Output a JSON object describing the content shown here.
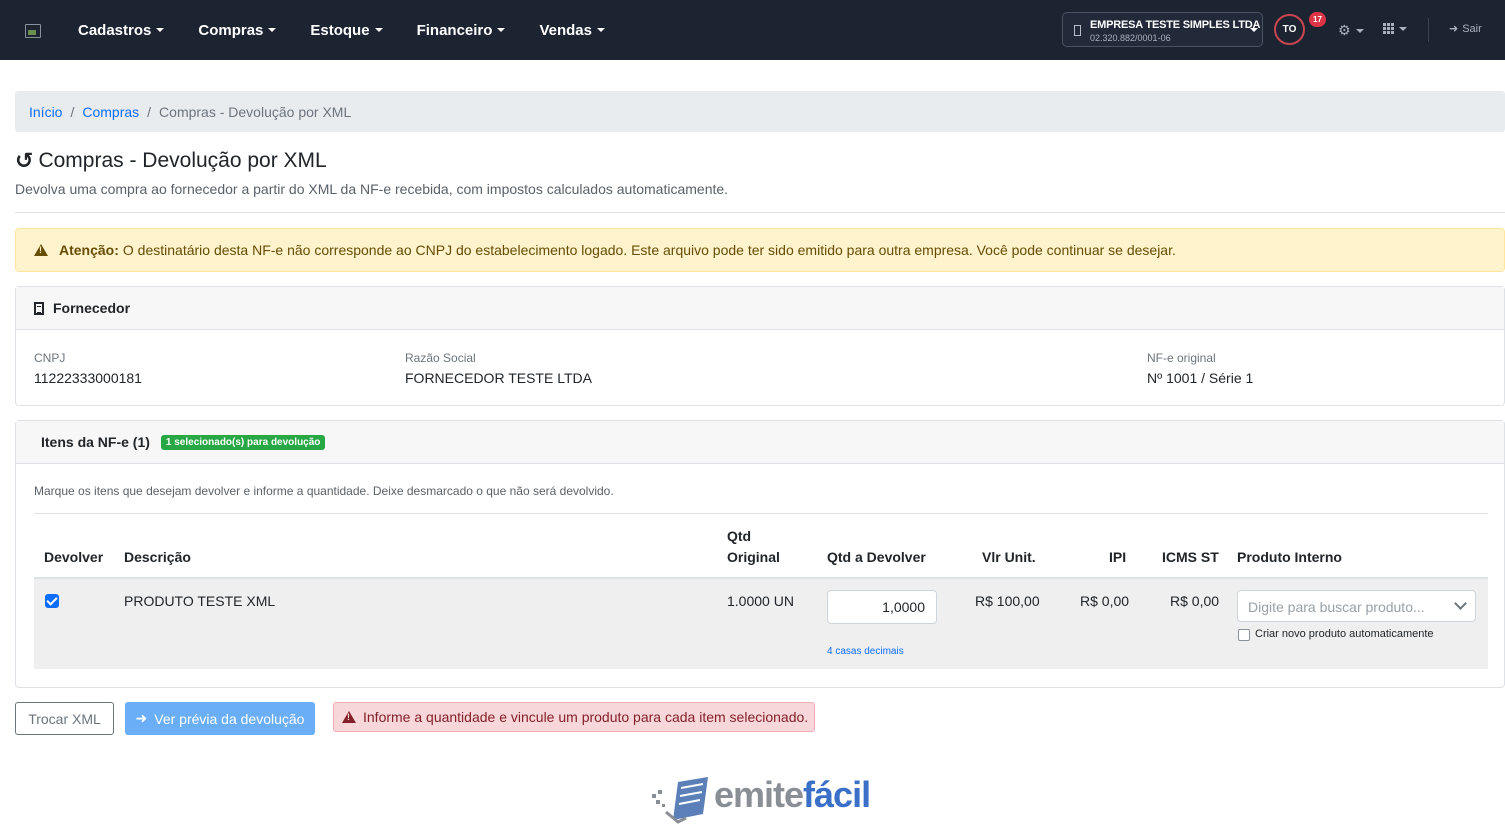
{
  "nav": {
    "menu": [
      {
        "label": "Cadastros"
      },
      {
        "label": "Compras"
      },
      {
        "label": "Estoque"
      },
      {
        "label": "Financeiro"
      },
      {
        "label": "Vendas"
      }
    ],
    "company": {
      "name": "EMPRESA TESTE SIMPLES LTDA",
      "cnpj": "02.320.882/0001-06"
    },
    "avatar_initials": "TO",
    "notification_count": "17",
    "logout_label": "Sair",
    "background_color": "#1c2331"
  },
  "breadcrumb": {
    "home": "Início",
    "section": "Compras",
    "current": "Compras - Devolução por XML"
  },
  "page": {
    "title": "Compras - Devolução por XML",
    "subtitle": "Devolva uma compra ao fornecedor a partir do XML da NF-e recebida, com impostos calculados automaticamente.",
    "title_icon": "undo-icon"
  },
  "warning": {
    "strong": "Atenção:",
    "text": "O destinatário desta NF-e não corresponde ao CNPJ do estabelecimento logado. Este arquivo pode ter sido emitido para outra empresa. Você pode continuar se desejar."
  },
  "fornecedor": {
    "header": "Fornecedor",
    "cnpj_label": "CNPJ",
    "cnpj_value": "11222333000181",
    "razao_label": "Razão Social",
    "razao_value": "FORNECEDOR TESTE LTDA",
    "nfe_label": "NF-e original",
    "nfe_value": "Nº 1001 / Série 1"
  },
  "itens": {
    "header": "Itens da NF-e (1)",
    "badge": "1 selecionado(s) para devolução",
    "badge_color": "#28a745",
    "instructions": "Marque os itens que desejam devolver e informe a quantidade. Deixe desmarcado o que não será devolvido.",
    "columns": {
      "devolver": "Devolver",
      "descricao": "Descrição",
      "qtd_original_1": "Qtd",
      "qtd_original_2": "Original",
      "qtd_devolver": "Qtd a Devolver",
      "vlr_unit": "Vlr Unit.",
      "ipi": "IPI",
      "icms_st": "ICMS ST",
      "produto_interno": "Produto Interno"
    },
    "rows": [
      {
        "checked": true,
        "descricao": "PRODUTO TESTE XML",
        "qtd_original": "1.0000 UN",
        "qtd_devolver": "1,0000",
        "decimals_hint": "4 casas decimais",
        "vlr_unit": "R$ 100,00",
        "ipi": "R$ 0,00",
        "icms_st": "R$ 0,00",
        "produto_placeholder": "Digite para buscar produto...",
        "novo_produto_label": "Criar novo produto automaticamente",
        "novo_produto_checked": false
      }
    ]
  },
  "actions": {
    "trocar_xml": "Trocar XML",
    "ver_previa": "Ver prévia da devolução",
    "error": "Informe a quantidade e vincule um produto para cada item selecionado.",
    "primary_color": "#6aaef7"
  },
  "footer": {
    "logo_part1": "emite",
    "logo_part2": "fácil"
  }
}
